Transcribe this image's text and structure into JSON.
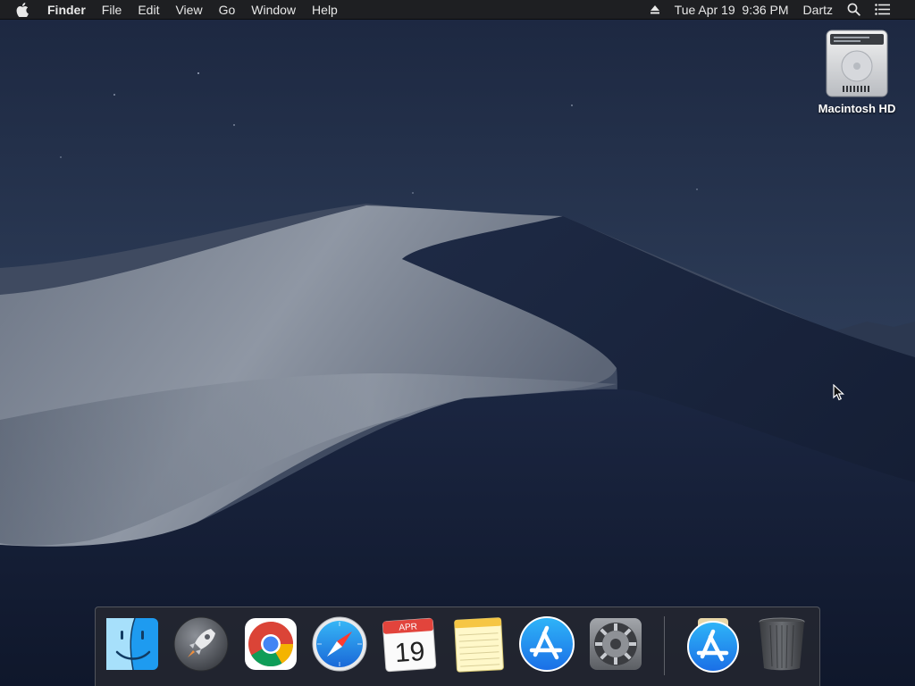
{
  "menubar": {
    "app_name": "Finder",
    "menus": [
      "File",
      "Edit",
      "View",
      "Go",
      "Window",
      "Help"
    ],
    "datetime": "Tue Apr 19  9:36 PM",
    "user": "Dartz",
    "icons": [
      "apple-icon",
      "eject-icon",
      "spotlight-search-icon",
      "notification-center-icon"
    ]
  },
  "desktop": {
    "drive_label": "Macintosh HD"
  },
  "dock": {
    "calendar_month": "APR",
    "calendar_day": "19",
    "apps": [
      "finder-icon",
      "launchpad-icon",
      "chrome-icon",
      "safari-icon",
      "calendar-icon",
      "notes-icon",
      "app-store-icon",
      "system-preferences-icon",
      "app-store-downloads-icon",
      "trash-icon"
    ]
  },
  "colors": {
    "menubar_bg": "#1e1f22",
    "sky_top": "#1c2740",
    "dune_light": "#7d8796",
    "dock_bg": "#282a30"
  }
}
